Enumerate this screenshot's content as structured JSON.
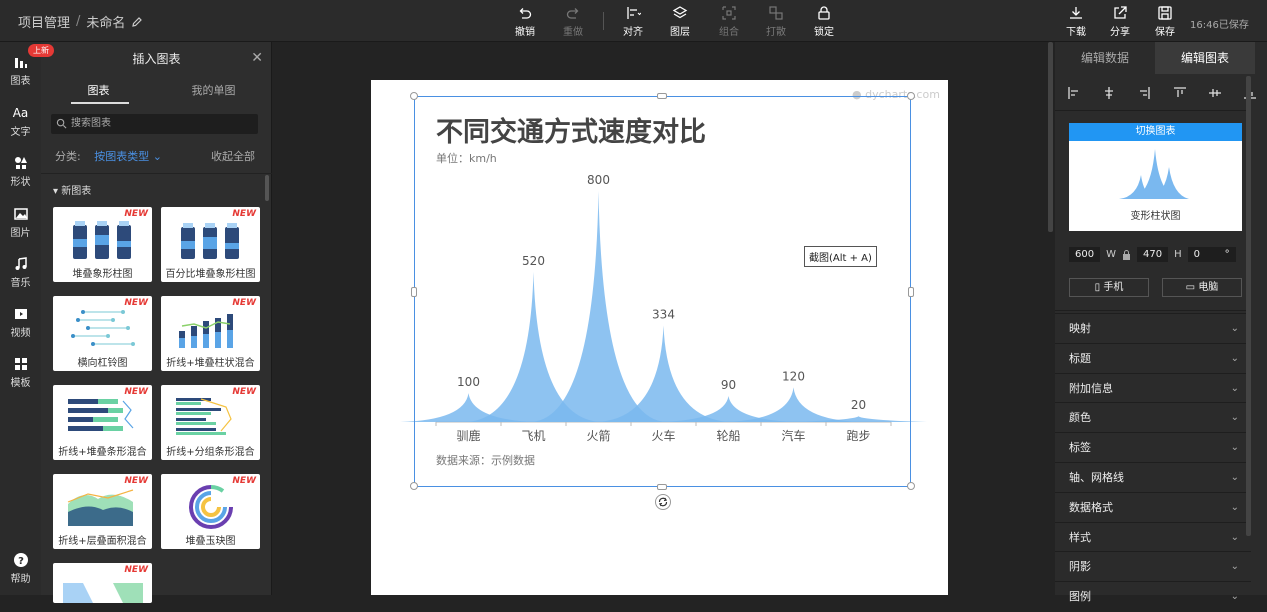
{
  "header": {
    "breadcrumb_root": "项目管理",
    "breadcrumb_sep": "/",
    "doc_name": "未命名",
    "toolbar": [
      {
        "label": "撤销",
        "icon": "undo-icon",
        "disabled": false
      },
      {
        "label": "重做",
        "icon": "redo-icon",
        "disabled": true
      },
      {
        "label": "对齐",
        "icon": "align-icon",
        "disabled": false
      },
      {
        "label": "图层",
        "icon": "layers-icon",
        "disabled": false
      },
      {
        "label": "组合",
        "icon": "group-icon",
        "disabled": true
      },
      {
        "label": "打散",
        "icon": "ungroup-icon",
        "disabled": true
      },
      {
        "label": "锁定",
        "icon": "lock-icon",
        "disabled": false
      }
    ],
    "right": [
      {
        "label": "下载",
        "icon": "download-icon"
      },
      {
        "label": "分享",
        "icon": "share-icon"
      },
      {
        "label": "保存",
        "icon": "save-icon"
      }
    ],
    "save_status": "16:46已保存"
  },
  "left_nav": {
    "badge": "上新",
    "items": [
      {
        "label": "图表",
        "icon": "chart-icon"
      },
      {
        "label": "文字",
        "icon": "text-icon"
      },
      {
        "label": "形状",
        "icon": "shape-icon"
      },
      {
        "label": "图片",
        "icon": "image-icon"
      },
      {
        "label": "音乐",
        "icon": "music-icon"
      },
      {
        "label": "视频",
        "icon": "video-icon"
      },
      {
        "label": "模板",
        "icon": "template-icon"
      }
    ],
    "help": "帮助"
  },
  "insert_panel": {
    "title": "插入图表",
    "tabs": [
      "图表",
      "我的单图"
    ],
    "search_placeholder": "搜索图表",
    "filter_label": "分类:",
    "filter_value": "按图表类型",
    "collapse_all": "收起全部",
    "section": "新图表",
    "new_badge": "NEW",
    "cards": [
      "堆叠象形柱图",
      "百分比堆叠象形柱图",
      "横向杠铃图",
      "折线+堆叠柱状混合",
      "折线+堆叠条形混合",
      "折线+分组条形混合",
      "折线+层叠面积混合",
      "堆叠玉玦图"
    ]
  },
  "canvas": {
    "watermark": "dycharts.com",
    "tooltip": "截图(Alt + A)"
  },
  "chart_data": {
    "type": "area",
    "title": "不同交通方式速度对比",
    "subtitle": "单位：km/h",
    "source": "数据来源：示例数据",
    "categories": [
      "驯鹿",
      "飞机",
      "火箭",
      "火车",
      "轮船",
      "汽车",
      "跑步"
    ],
    "values": [
      100,
      520,
      800,
      334,
      90,
      120,
      20
    ],
    "ylim": [
      0,
      800
    ],
    "color": "#7ab8ef",
    "grid": false
  },
  "right_panel": {
    "tabs": [
      "编辑数据",
      "编辑图表"
    ],
    "switch_chart": "切换图表",
    "chart_name": "变形柱状图",
    "width": "600",
    "width_label": "W",
    "height": "470",
    "height_label": "H",
    "rotation": "0",
    "rotation_unit": "°",
    "mobile": "手机",
    "desktop": "电脑",
    "sections": [
      "映射",
      "标题",
      "附加信息",
      "颜色",
      "标签",
      "轴、网格线",
      "数据格式",
      "样式",
      "阴影",
      "图例"
    ]
  }
}
